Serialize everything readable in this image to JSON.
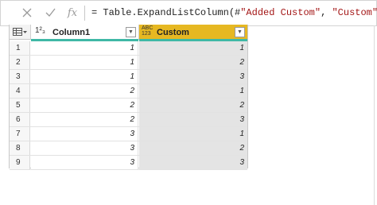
{
  "formula_bar": {
    "cancel_icon": "x-icon",
    "commit_icon": "check-icon",
    "fx_label": "fx",
    "formula_prefix": "= Table.ExpandListColumn(#",
    "formula_arg1": "\"Added Custom\"",
    "formula_sep": ", ",
    "formula_arg2": "\"Custom\"",
    "formula_suffix": ")"
  },
  "grid": {
    "columns": [
      {
        "type_label": "1²₃",
        "name": "Column1"
      },
      {
        "type_label": "ABC 123",
        "name": "Custom"
      }
    ],
    "rows": [
      {
        "index": "1",
        "column1": "1",
        "custom": "1"
      },
      {
        "index": "2",
        "column1": "1",
        "custom": "2"
      },
      {
        "index": "3",
        "column1": "1",
        "custom": "3"
      },
      {
        "index": "4",
        "column1": "2",
        "custom": "1"
      },
      {
        "index": "5",
        "column1": "2",
        "custom": "2"
      },
      {
        "index": "6",
        "column1": "2",
        "custom": "3"
      },
      {
        "index": "7",
        "column1": "3",
        "custom": "1"
      },
      {
        "index": "8",
        "column1": "3",
        "custom": "2"
      },
      {
        "index": "9",
        "column1": "3",
        "custom": "3"
      }
    ]
  },
  "colors": {
    "selected_header": "#e6b822",
    "quality_bar": "#3fb8a6"
  }
}
